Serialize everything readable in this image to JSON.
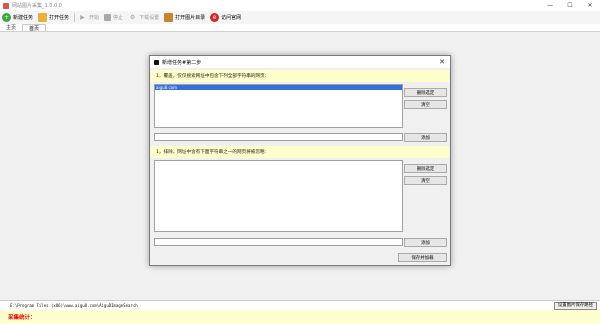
{
  "window": {
    "title": "网站图片采集_1.0.0.0",
    "min": "—",
    "max": "☐",
    "close": "✕"
  },
  "toolbar": {
    "new_task": "新建任务",
    "open_task": "打开任务",
    "start": "开始",
    "stop": "停止",
    "settings": "下载设置",
    "open_dir": "打开图片目录",
    "visit_site": "访问官网"
  },
  "tabs": [
    "主页",
    "首页"
  ],
  "dialog": {
    "title": "新增任务#第二步",
    "section1_label": "1，覆盖，仅仅搜索网址中包含下列全部字符串的网页：",
    "section1_items": [
      "aigu8.com"
    ],
    "section2_label": "1，排除，网址中含有下面字符串之一的网页将被忽略：",
    "section2_items": [],
    "delete_selected": "删除选定",
    "clear": "清空",
    "add": "添加",
    "save_load": "保存并加载",
    "close": "✕"
  },
  "status": {
    "path": "E:\\Program Files (x86)\\www.aigu8.com\\AiguDImageSearch",
    "set_dir_button": "设置图片保存路径",
    "stats_label": "采集统计："
  },
  "colors": {
    "stats_text": "#e00000",
    "section_bg": "#ffffcc",
    "selected_item": "#3370d8"
  }
}
